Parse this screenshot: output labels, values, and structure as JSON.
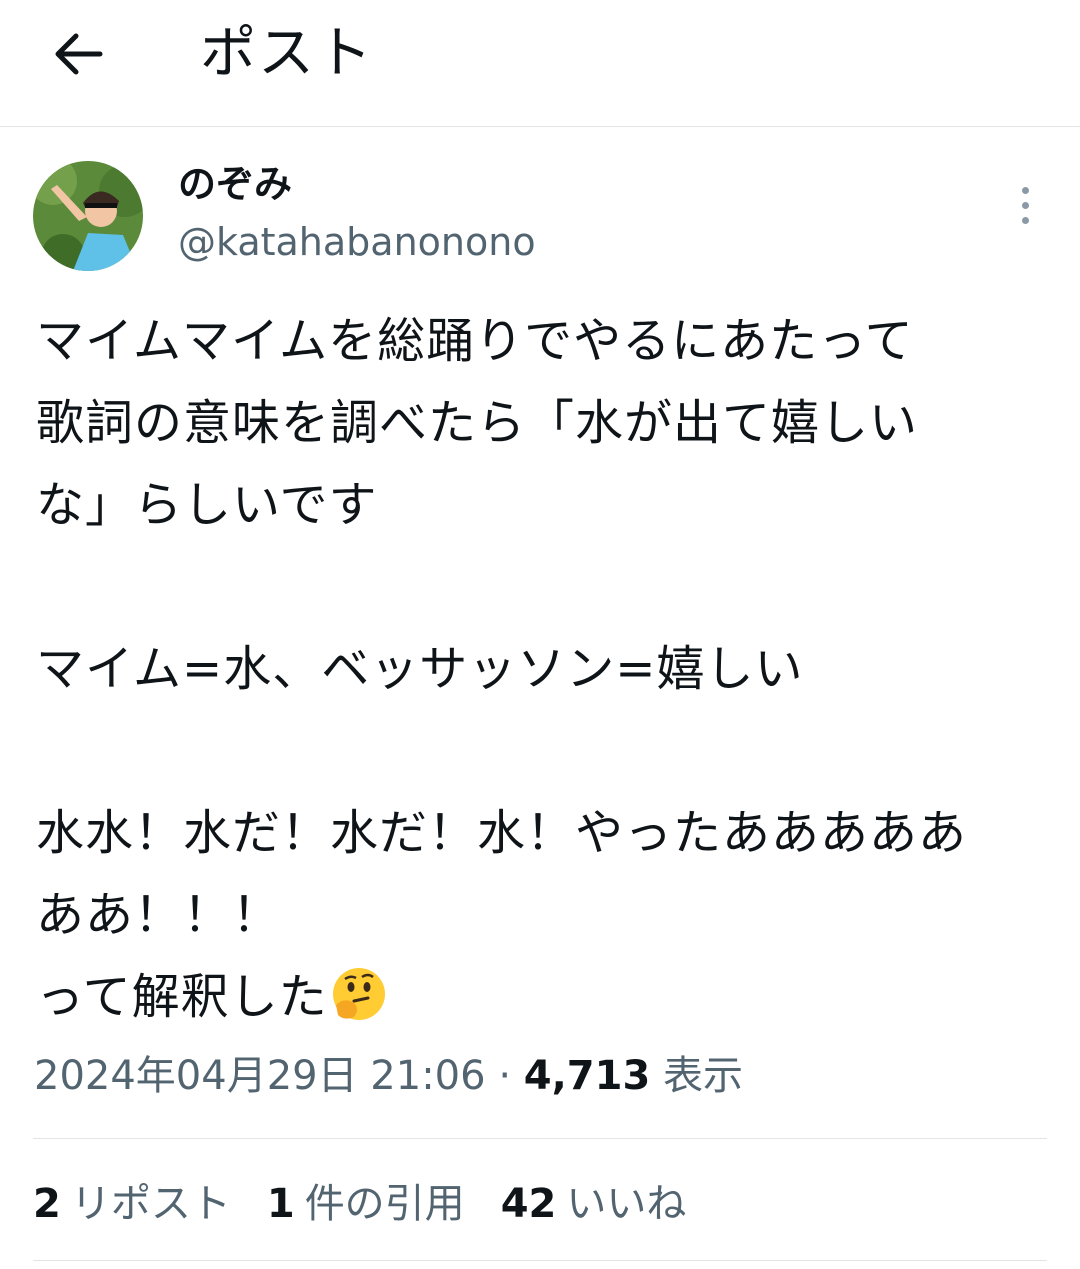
{
  "header": {
    "title": "ポスト"
  },
  "author": {
    "display_name": "のぞみ",
    "handle": "@katahabanonono"
  },
  "tweet": {
    "text": "マイムマイムを総踊りでやるにあたって\n歌詞の意味を調べたら「水が出て嬉しい\nな」らしいです\n\nマイム=水、ベッサッソン=嬉しい\n\n水水！水だ！水だ！水！やったあああああ\nああ！！！\nって解釈した",
    "trailing_emoji": "thinking-face-emoji"
  },
  "meta": {
    "timestamp": "2024年04月29日 21:06",
    "separator": "·",
    "views_count": "4,713",
    "views_label": "表示"
  },
  "stats": {
    "reposts": {
      "count": "2",
      "label": "リポスト"
    },
    "quotes": {
      "count": "1",
      "label": "件の引用"
    },
    "likes": {
      "count": "42",
      "label": "いいね"
    }
  },
  "colors": {
    "text": "#0f1419",
    "secondary": "#536471",
    "divider": "#e1e5e8"
  }
}
